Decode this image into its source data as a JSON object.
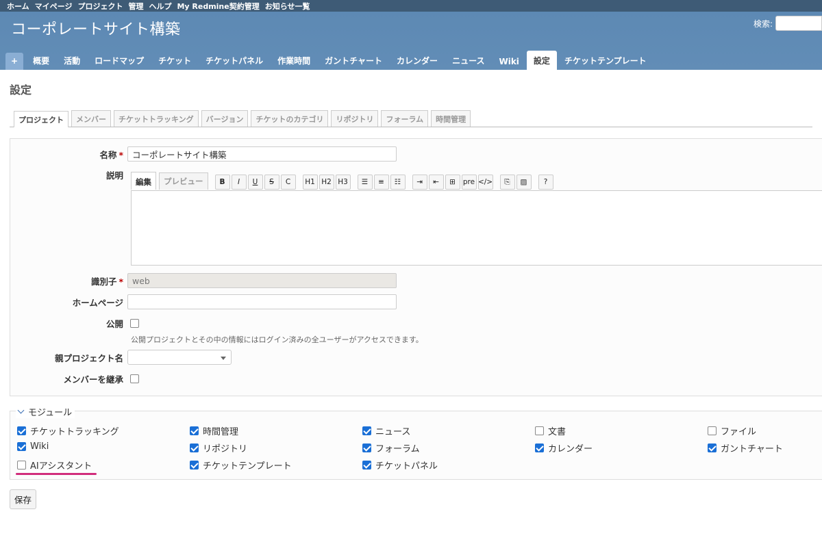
{
  "top_menu": [
    "ホーム",
    "マイページ",
    "プロジェクト",
    "管理",
    "ヘルプ",
    "My Redmine契約管理",
    "お知らせ一覧"
  ],
  "header": {
    "title": "コーポレートサイト構築",
    "search_label": "検索:"
  },
  "main_menu": {
    "plus": "+",
    "tabs": [
      "概要",
      "活動",
      "ロードマップ",
      "チケット",
      "チケットパネル",
      "作業時間",
      "ガントチャート",
      "カレンダー",
      "ニュース",
      "Wiki",
      "設定",
      "チケットテンプレート"
    ],
    "selected": "設定"
  },
  "page_title": "設定",
  "subtabs": [
    "プロジェクト",
    "メンバー",
    "チケットトラッキング",
    "バージョン",
    "チケットのカテゴリ",
    "リポジトリ",
    "フォーラム",
    "時間管理"
  ],
  "form": {
    "name_label": "名称",
    "name_value": "コーポレートサイト構築",
    "desc_label": "説明",
    "editor_tab_edit": "編集",
    "editor_tab_preview": "プレビュー",
    "toolbar": [
      "B",
      "I",
      "U",
      "S",
      "C",
      "H1",
      "H2",
      "H3",
      "ul",
      "ol",
      "task",
      "indent",
      "outdent",
      "table",
      "pre",
      "code",
      "link",
      "image",
      "help"
    ],
    "identifier_label": "識別子",
    "identifier_value": "web",
    "homepage_label": "ホームページ",
    "public_label": "公開",
    "public_hint": "公開プロジェクトとその中の情報にはログイン済みの全ユーザーがアクセスできます。",
    "parent_label": "親プロジェクト名",
    "inherit_label": "メンバーを継承"
  },
  "modules": {
    "legend": "モジュール",
    "items": [
      {
        "label": "チケットトラッキング",
        "checked": true
      },
      {
        "label": "時間管理",
        "checked": true
      },
      {
        "label": "ニュース",
        "checked": true
      },
      {
        "label": "文書",
        "checked": false
      },
      {
        "label": "ファイル",
        "checked": false
      },
      {
        "label": "Wiki",
        "checked": true
      },
      {
        "label": "リポジトリ",
        "checked": true
      },
      {
        "label": "フォーラム",
        "checked": true
      },
      {
        "label": "カレンダー",
        "checked": true
      },
      {
        "label": "ガントチャート",
        "checked": true
      },
      {
        "label": "AIアシスタント",
        "checked": false
      },
      {
        "label": "チケットテンプレート",
        "checked": true
      },
      {
        "label": "チケットパネル",
        "checked": true
      }
    ]
  },
  "save_label": "保存",
  "colors": {
    "header": "#628db6",
    "top_menu": "#3e5b76",
    "required": "#bb0000",
    "highlight": "#d12d7c",
    "checkbox": "#1a6fd6"
  }
}
